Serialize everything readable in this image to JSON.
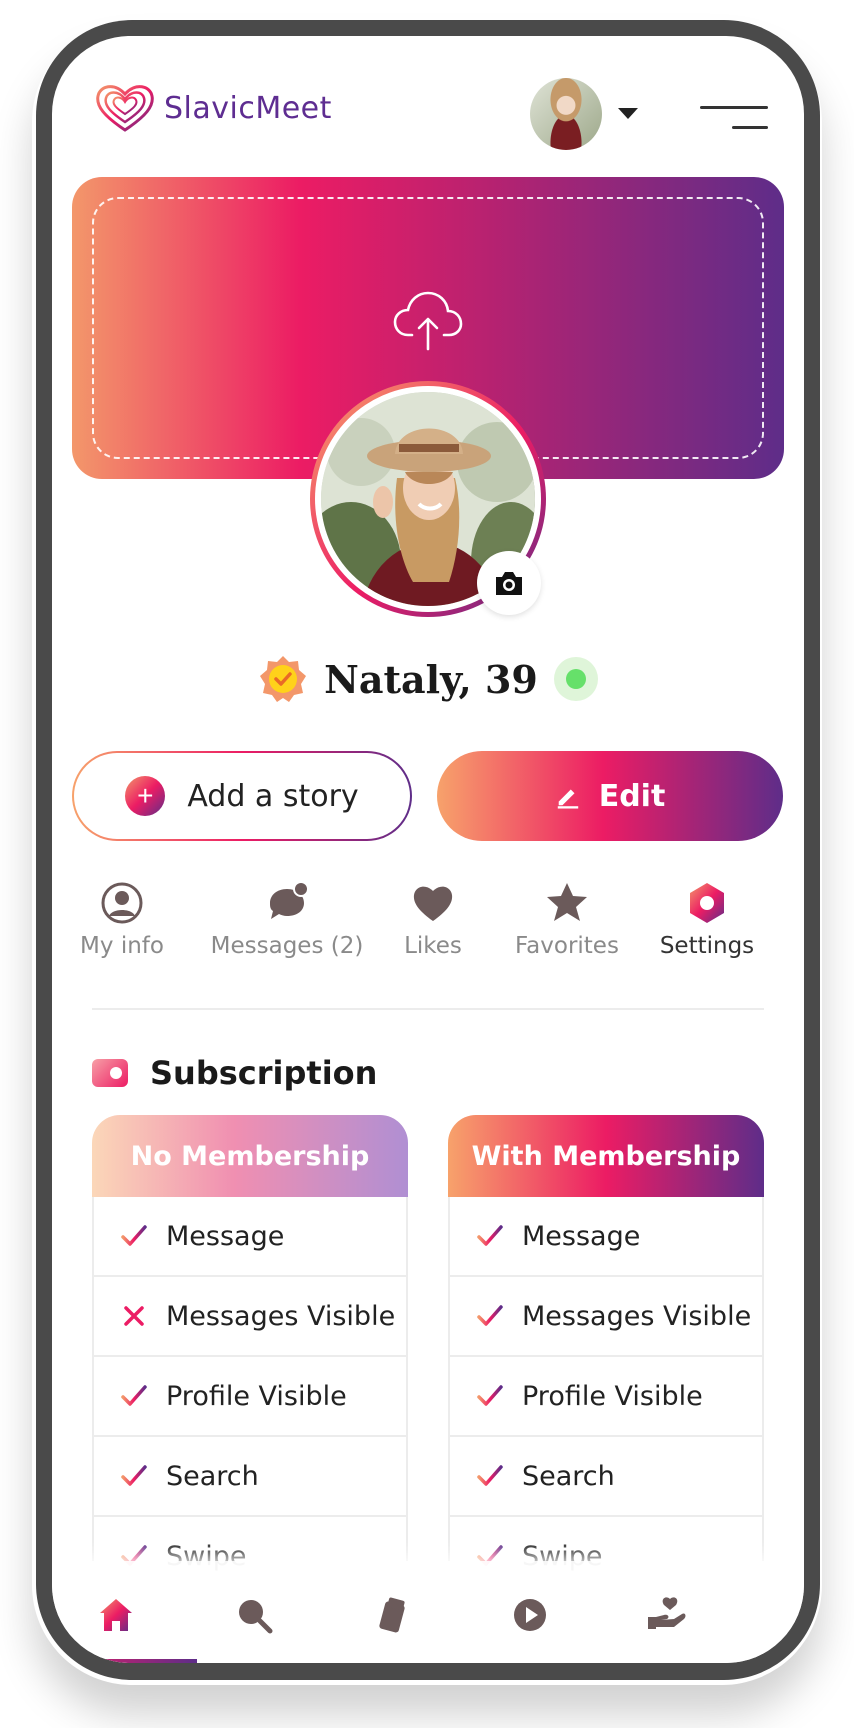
{
  "app": {
    "brand_name": "SlavicMeet"
  },
  "header": {
    "avatar": "user-avatar",
    "menu_icon": "hamburger-icon"
  },
  "cover": {
    "upload_icon": "cloud-upload-icon"
  },
  "profile": {
    "name_age": "Nataly, 39",
    "verified_icon": "verified-badge-icon",
    "online": true,
    "photo_icon": "camera-icon"
  },
  "actions": {
    "add_story_label": "Add a story",
    "edit_label": "Edit"
  },
  "tabs": [
    {
      "label": "My info",
      "icon": "user-circle-icon"
    },
    {
      "label": "Messages (2)",
      "icon": "chat-bubble-icon"
    },
    {
      "label": "Likes",
      "icon": "heart-icon"
    },
    {
      "label": "Favorites",
      "icon": "star-icon"
    },
    {
      "label": "Settings",
      "icon": "settings-hexagon-icon",
      "active": true
    }
  ],
  "subscription": {
    "title": "Subscription",
    "plans": [
      {
        "title": "No Membership",
        "features": [
          {
            "label": "Message",
            "included": true
          },
          {
            "label": "Messages Visible",
            "included": false
          },
          {
            "label": "Profile Visible",
            "included": true
          },
          {
            "label": "Search",
            "included": true
          },
          {
            "label": "Swipe",
            "included": true
          }
        ]
      },
      {
        "title": "With Membership",
        "features": [
          {
            "label": "Message",
            "included": true
          },
          {
            "label": "Messages Visible",
            "included": true
          },
          {
            "label": "Profile Visible",
            "included": true
          },
          {
            "label": "Search",
            "included": true
          },
          {
            "label": "Swipe",
            "included": true
          }
        ]
      }
    ]
  },
  "bottom_nav": [
    {
      "icon": "home-icon",
      "active": true
    },
    {
      "icon": "search-icon"
    },
    {
      "icon": "cards-icon"
    },
    {
      "icon": "play-icon"
    },
    {
      "icon": "hand-heart-icon"
    }
  ],
  "colors": {
    "brand_purple": "#5e2d91",
    "brand_pink": "#ec1c64",
    "brand_orange": "#f7a26b",
    "online_green": "#66e06a"
  }
}
